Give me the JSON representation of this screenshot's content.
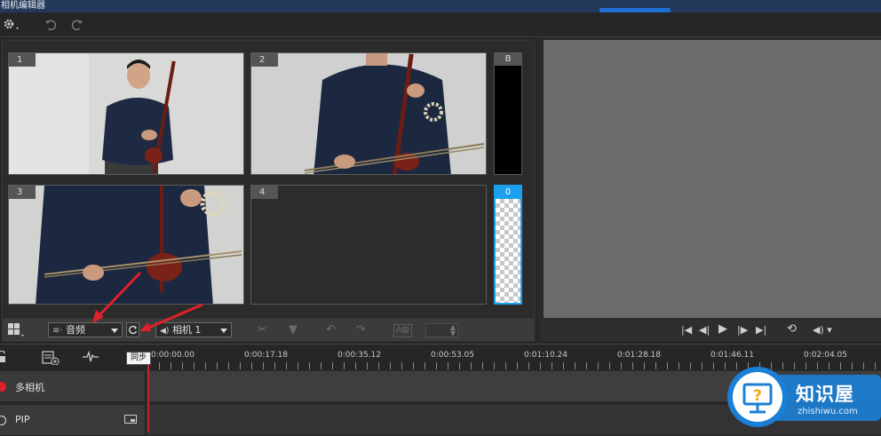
{
  "window": {
    "title": "相机编辑器"
  },
  "toolbar": {
    "settings_icon": "gear-icon",
    "undo_icon": "undo-icon",
    "redo_icon": "redo-icon"
  },
  "cameras": [
    {
      "label": "1"
    },
    {
      "label": "2"
    },
    {
      "label": "3"
    },
    {
      "label": "4"
    }
  ],
  "side_slots": [
    {
      "label": "B"
    },
    {
      "label": "0"
    }
  ],
  "camera_toolbar": {
    "layout_icon": "grid-layout-icon",
    "sync_source": {
      "selected": "音频"
    },
    "sync_button_icon": "sync-icon",
    "audio_source": {
      "selected": "相机 1"
    },
    "split_icon": "scissors-icon",
    "marker_icon": "marker-icon",
    "rotate_left_icon": "rotate-left-icon",
    "rotate_right_icon": "rotate-right-icon",
    "text_icon": "text-box-icon",
    "stepper_value": ""
  },
  "tooltip": {
    "text": "同步"
  },
  "player": {
    "buttons": [
      "skip-start-icon",
      "step-back-icon",
      "play-icon",
      "step-forward-icon",
      "skip-end-icon",
      "repeat-icon",
      "volume-icon"
    ]
  },
  "timeline": {
    "tools": [
      "lock-icon",
      "add-track-icon",
      "audio-wave-icon"
    ],
    "ticks": [
      "0:00:00.00",
      "0:00:17.18",
      "0:00:35.12",
      "0:00:53.05",
      "0:01:10.24",
      "0:01:28.18",
      "0:01:46.11",
      "0:02:04.05"
    ],
    "tracks": [
      {
        "name": "多相机",
        "indicator": "record"
      },
      {
        "name": "PIP",
        "indicator": "ring"
      }
    ]
  },
  "watermark": {
    "title": "知识屋",
    "url": "zhishiwu.com"
  },
  "colors": {
    "accent": "#1aa0ef",
    "playhead": "#c8222a",
    "annotation": "#e0202a"
  }
}
